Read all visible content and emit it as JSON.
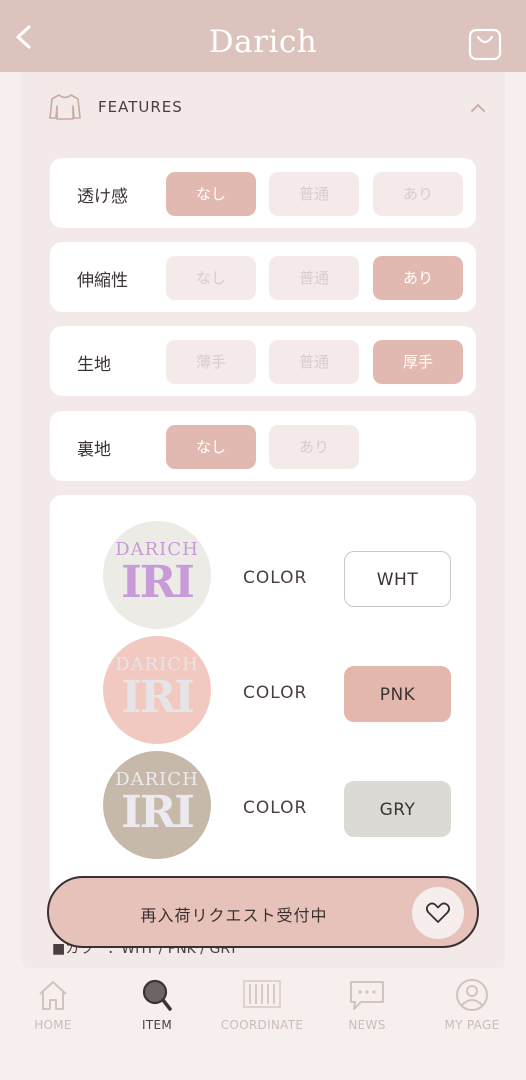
{
  "header": {
    "brand": "Darich"
  },
  "features": {
    "title": "FEATURES",
    "rows": [
      {
        "label": "透け感",
        "options": [
          "なし",
          "普通",
          "あり"
        ],
        "selected": "なし"
      },
      {
        "label": "伸縮性",
        "options": [
          "なし",
          "普通",
          "あり"
        ],
        "selected": "あり"
      },
      {
        "label": "生地",
        "options": [
          "薄手",
          "普通",
          "厚手"
        ],
        "selected": "厚手"
      },
      {
        "label": "裏地",
        "options": [
          "なし",
          "あり"
        ],
        "selected": "なし"
      }
    ]
  },
  "colors": [
    {
      "label": "COLOR",
      "code": "WHT",
      "swatch_logo_top": "DARICH",
      "swatch_logo_main": "IRI",
      "swatch_bg": "#ecebe6",
      "logo_color": "#c79ad8",
      "chip_bg": "#ffffff",
      "chip_text": "#3c3434",
      "chip_border": "#cfc6c6"
    },
    {
      "label": "COLOR",
      "code": "PNK",
      "swatch_logo_top": "DARICH",
      "swatch_logo_main": "IRI",
      "swatch_bg": "#f1c9c0",
      "logo_color": "#e6e4e6",
      "chip_bg": "#e4b7ad",
      "chip_text": "#3c3434",
      "chip_border": "#e4b7ad"
    },
    {
      "label": "COLOR",
      "code": "GRY",
      "swatch_logo_top": "DARICH",
      "swatch_logo_main": "IRI",
      "swatch_bg": "#c6b9a9",
      "logo_color": "#eceaf0",
      "chip_bg": "#dcdad5",
      "chip_text": "#3c3434",
      "chip_border": "#dcdad5"
    }
  ],
  "spec_line": "■カラー：WHT / PNK / GRY",
  "restock_button": "再入荷リクエスト受付中",
  "tabs": [
    {
      "label": "HOME",
      "icon": "home-icon",
      "active": false
    },
    {
      "label": "ITEM",
      "icon": "search-icon",
      "active": true
    },
    {
      "label": "COORDINATE",
      "icon": "coordinate-icon",
      "active": false
    },
    {
      "label": "NEWS",
      "icon": "news-icon",
      "active": false
    },
    {
      "label": "MY PAGE",
      "icon": "user-icon",
      "active": false
    }
  ],
  "theme": {
    "header_bg": "#dcc3bd",
    "accent": "#e2b9b1",
    "page_bg": "#f7eeee"
  }
}
